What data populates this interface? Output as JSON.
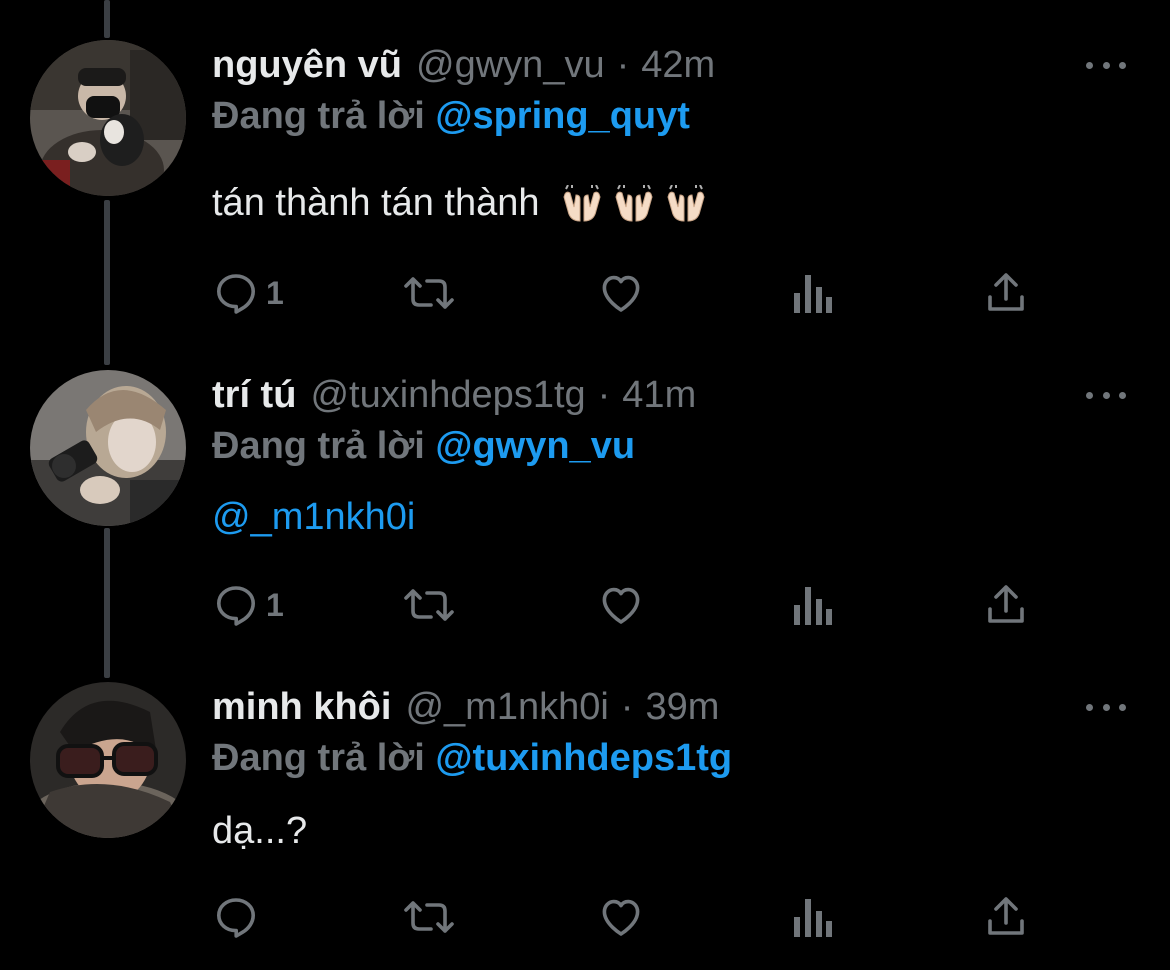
{
  "tweets": [
    {
      "name": "nguyên vũ",
      "handle": "@gwyn_vu",
      "time": "42m",
      "reply_prefix": "Đang trả lời",
      "reply_to": "@spring_quyt",
      "text": "tán thành tán thành",
      "emoji": [
        "raised-hands",
        "raised-hands",
        "raised-hands"
      ],
      "reply_count": "1"
    },
    {
      "name": "trí tú",
      "handle": "@tuxinhdeps1tg",
      "time": "41m",
      "reply_prefix": "Đang trả lời",
      "reply_to": "@gwyn_vu",
      "text": "@_m1nkh0i",
      "reply_count": "1"
    },
    {
      "name": "minh khôi",
      "handle": "@_m1nkh0i",
      "time": "39m",
      "reply_prefix": "Đang trả lời",
      "reply_to": "@tuxinhdeps1tg",
      "text": "dạ...?",
      "reply_count": ""
    }
  ],
  "theme": {
    "background": "#000000",
    "text": "#e7e9ea",
    "muted": "#71767b",
    "link": "#1d9bf0",
    "thread_line": "#3b3f44"
  },
  "icons": [
    "reply-icon",
    "retweet-icon",
    "like-icon",
    "analytics-icon",
    "share-icon",
    "more-icon"
  ]
}
